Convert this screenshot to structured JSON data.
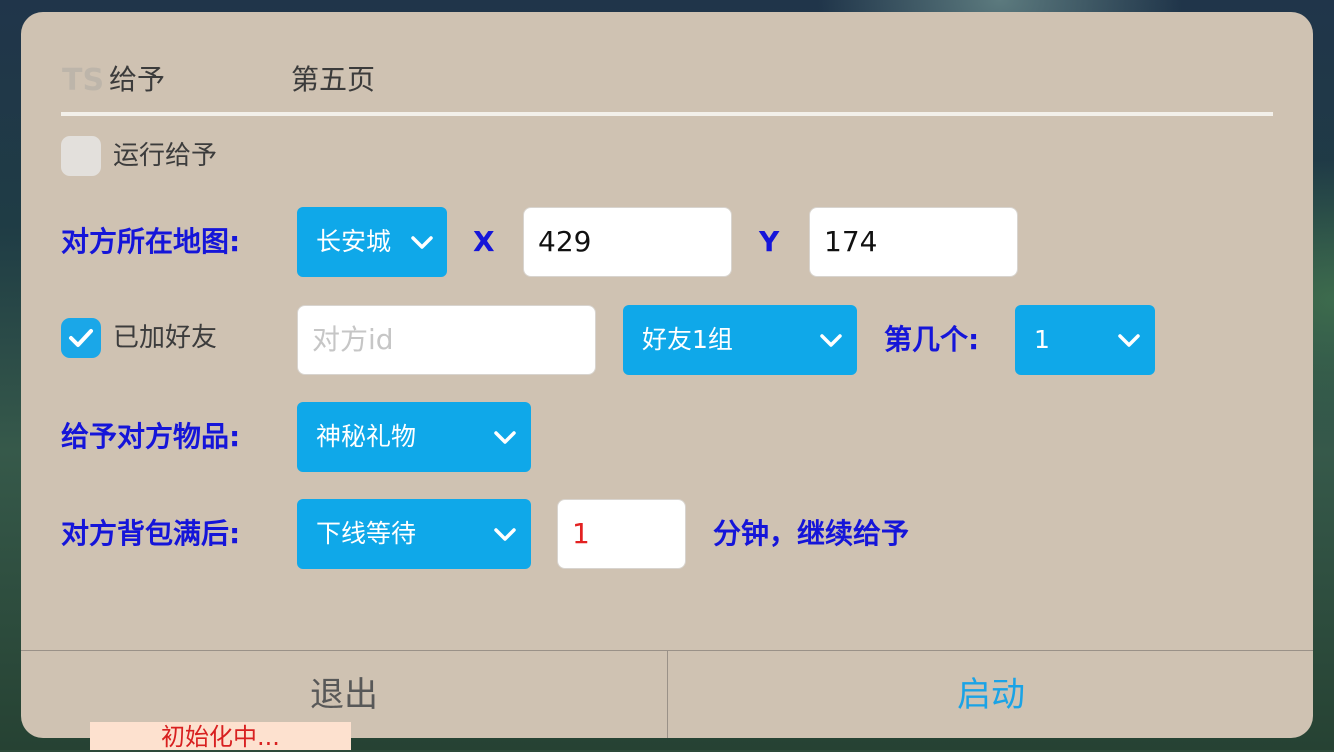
{
  "tabs": [
    {
      "label": "给予"
    },
    {
      "label": "第五页"
    }
  ],
  "run_checkbox": {
    "label": "运行给予",
    "checked": false
  },
  "map_row": {
    "label": "对方所在地图:",
    "map_select": "长安城",
    "x_label": "X",
    "x_value": "429",
    "y_label": "Y",
    "y_value": "174"
  },
  "friend_row": {
    "checkbox_label": "已加好友",
    "checked": true,
    "id_placeholder": "对方id",
    "group_select": "好友1组",
    "index_label": "第几个:",
    "index_select": "1"
  },
  "item_row": {
    "label": "给予对方物品:",
    "item_select": "神秘礼物"
  },
  "bag_row": {
    "label": "对方背包满后:",
    "action_select": "下线等待",
    "minutes_value": "1",
    "suffix": "分钟，继续给予"
  },
  "footer": {
    "exit_label": "退出",
    "start_label": "启动"
  },
  "toast": {
    "text": "初始化中..."
  },
  "colors": {
    "dialog_bg": "#cfc2b2",
    "accent": "#0fa8e9",
    "label_blue": "#1515d9",
    "start_text": "#1aa3e6"
  }
}
